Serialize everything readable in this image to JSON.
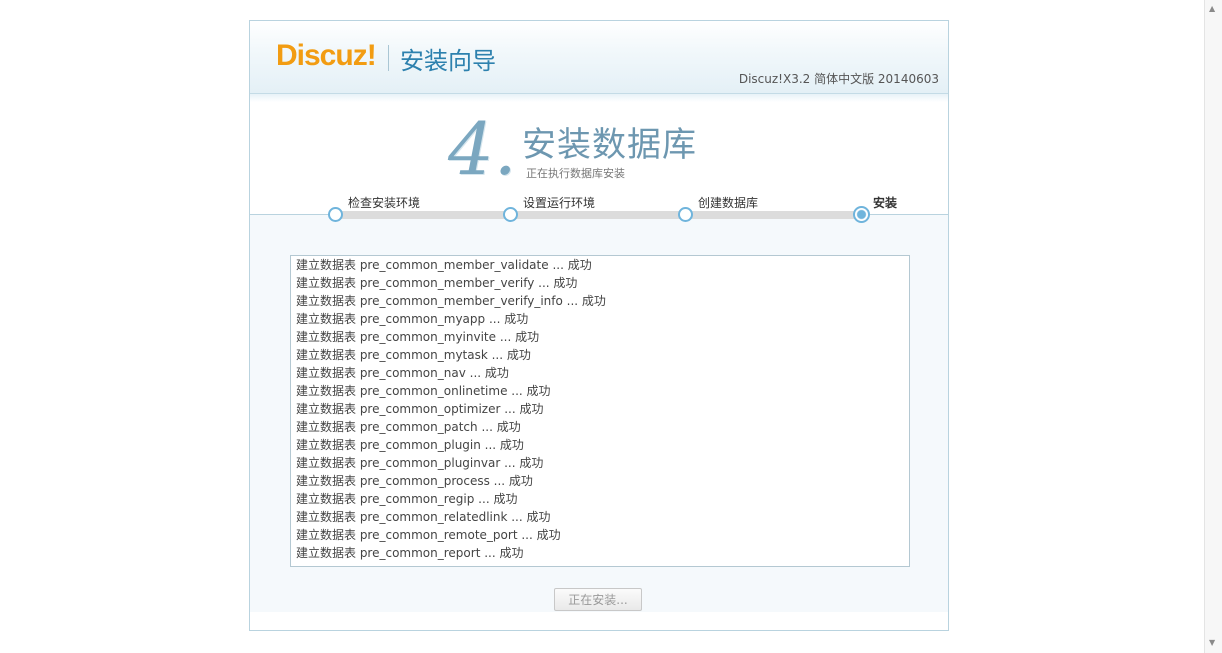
{
  "header": {
    "logo": "Discuz!",
    "wizard_title": "安装向导",
    "version": "Discuz!X3.2 简体中文版 20140603"
  },
  "step": {
    "number": "4.",
    "title": "安装数据库",
    "subtitle": "正在执行数据库安装"
  },
  "steps": [
    {
      "label": "检查安装环境",
      "state": "done"
    },
    {
      "label": "设置运行环境",
      "state": "done"
    },
    {
      "label": "创建数据库",
      "state": "done"
    },
    {
      "label": "安装",
      "state": "current"
    }
  ],
  "log": [
    "建立数据表 pre_common_member_validate ... 成功",
    "建立数据表 pre_common_member_verify ... 成功",
    "建立数据表 pre_common_member_verify_info ... 成功",
    "建立数据表 pre_common_myapp ... 成功",
    "建立数据表 pre_common_myinvite ... 成功",
    "建立数据表 pre_common_mytask ... 成功",
    "建立数据表 pre_common_nav ... 成功",
    "建立数据表 pre_common_onlinetime ... 成功",
    "建立数据表 pre_common_optimizer ... 成功",
    "建立数据表 pre_common_patch ... 成功",
    "建立数据表 pre_common_plugin ... 成功",
    "建立数据表 pre_common_pluginvar ... 成功",
    "建立数据表 pre_common_process ... 成功",
    "建立数据表 pre_common_regip ... 成功",
    "建立数据表 pre_common_relatedlink ... 成功",
    "建立数据表 pre_common_remote_port ... 成功",
    "建立数据表 pre_common_report ... 成功"
  ],
  "button": {
    "label": "正在安装..."
  },
  "colors": {
    "accent": "#2d81ae",
    "logo": "#f29c12",
    "step_dot": "#6fb4dc"
  }
}
